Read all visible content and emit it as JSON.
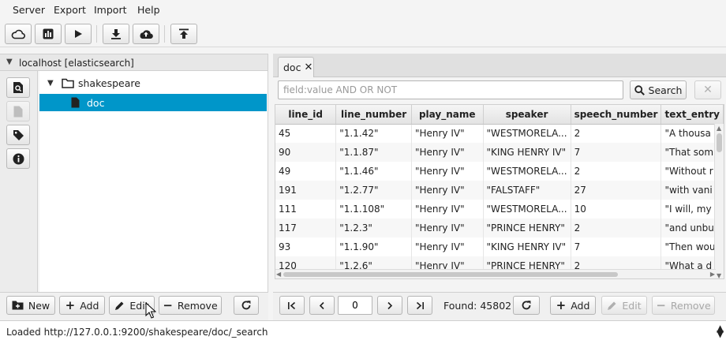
{
  "menu": [
    "Server",
    "Export",
    "Import",
    "Help"
  ],
  "connection": {
    "label": "localhost [elasticsearch]"
  },
  "tree": {
    "index": "shakespeare",
    "type": "doc"
  },
  "left_footer": {
    "new": "New",
    "add": "Add",
    "edit": "Edit",
    "remove": "Remove"
  },
  "tab": {
    "label": "doc"
  },
  "search": {
    "placeholder": "field:value AND OR NOT",
    "value": "",
    "button": "Search"
  },
  "table": {
    "columns": [
      "line_id",
      "line_number",
      "play_name",
      "speaker",
      "speech_number",
      "text_entry"
    ],
    "rows": [
      [
        "45",
        "\"1.1.42\"",
        "\"Henry IV\"",
        "\"WESTMORELA...",
        "2",
        "\"A thousa"
      ],
      [
        "90",
        "\"1.1.87\"",
        "\"Henry IV\"",
        "\"KING HENRY IV\"",
        "7",
        "\"That som"
      ],
      [
        "49",
        "\"1.1.46\"",
        "\"Henry IV\"",
        "\"WESTMORELA...",
        "2",
        "\"Without r"
      ],
      [
        "191",
        "\"1.2.77\"",
        "\"Henry IV\"",
        "\"FALSTAFF\"",
        "27",
        "\"with vani"
      ],
      [
        "111",
        "\"1.1.108\"",
        "\"Henry IV\"",
        "\"WESTMORELA...",
        "10",
        "\"I will, my"
      ],
      [
        "117",
        "\"1.2.3\"",
        "\"Henry IV\"",
        "\"PRINCE HENRY\"",
        "2",
        "\"and unbu"
      ],
      [
        "93",
        "\"1.1.90\"",
        "\"Henry IV\"",
        "\"KING HENRY IV\"",
        "7",
        "\"Then wou"
      ],
      [
        "120",
        "\"1.2.6\"",
        "\"Henry IV\"",
        "\"PRINCE HENRY\"",
        "2",
        "\"What a d"
      ],
      [
        "",
        "",
        "",
        "",
        "",
        ""
      ]
    ]
  },
  "pager": {
    "page": "0",
    "found": "Found: 45802",
    "add": "Add",
    "edit": "Edit",
    "remove": "Remove"
  },
  "status": {
    "text": "Loaded http://127.0.0.1:9200/shakespeare/doc/_search"
  },
  "colors": {
    "selection": "#0096c9"
  }
}
